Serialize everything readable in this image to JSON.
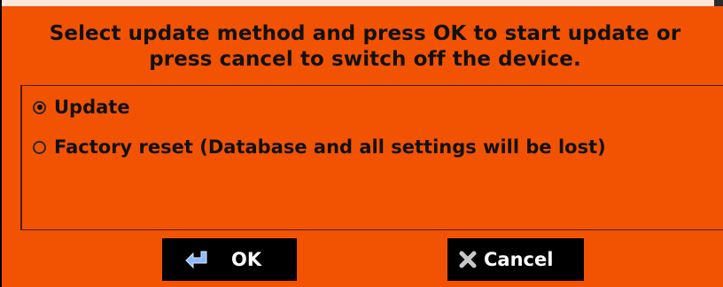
{
  "dialog": {
    "prompt_line1": "Select update method and press OK to start update or",
    "prompt_line2": "press cancel to switch off the device.",
    "options": [
      {
        "label": "Update",
        "selected": true
      },
      {
        "label": "Factory reset (Database and all settings will be lost)",
        "selected": false
      }
    ],
    "buttons": {
      "ok_label": "OK",
      "ok_icon": "enter-arrow-icon",
      "cancel_label": "Cancel",
      "cancel_icon": "close-x-icon"
    }
  },
  "colors": {
    "background": "#f25302",
    "button_bg": "#000000",
    "button_text": "#ffffff",
    "text": "#111111",
    "icon_blue": "#8fb8ff",
    "icon_gray": "#c8c8c8"
  }
}
